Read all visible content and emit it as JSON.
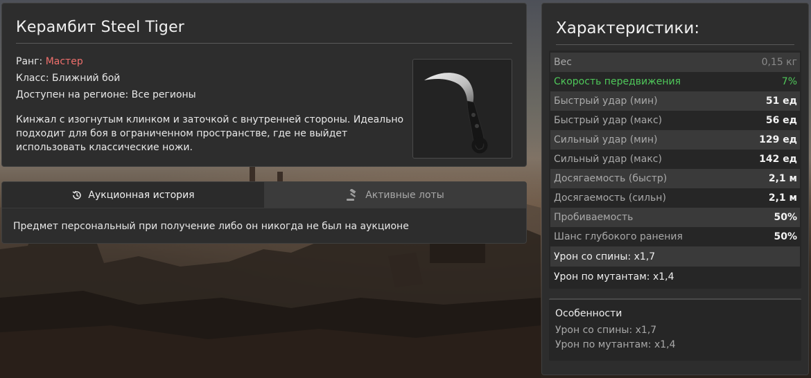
{
  "item": {
    "title": "Керамбит Steel Tiger",
    "rank_label": "Ранг:",
    "rank_value": "Мастер",
    "class_line": "Класс: Ближний бой",
    "region_line": "Доступен на регионе: Все регионы",
    "description": "Кинжал с изогнутым клинком и заточкой с внутренней стороны. Идеально подходит для боя в ограниченном пространстве, где не выйдет использовать классические ножи.",
    "image_icon": "karambit-knife-image"
  },
  "history": {
    "tabs": [
      {
        "label": "Аукционная история",
        "icon": "history-icon",
        "active": true
      },
      {
        "label": "Активные лоты",
        "icon": "gavel-icon",
        "active": false
      }
    ],
    "message": "Предмет персональный при получение либо он никогда не был на аукционе"
  },
  "stats": {
    "title": "Характеристики:",
    "rows": [
      {
        "label": "Вес",
        "value": "0,15 кг"
      },
      {
        "label": "Скорость передвижения",
        "value": "7%"
      },
      {
        "label": "Быстрый удар (мин)",
        "value": "51 ед"
      },
      {
        "label": "Быстрый удар (макс)",
        "value": "56 ед"
      },
      {
        "label": "Сильный удар (мин)",
        "value": "129 ед"
      },
      {
        "label": "Сильный удар (макс)",
        "value": "142 ед"
      },
      {
        "label": "Досягаемость (быстр)",
        "value": "2,1 м"
      },
      {
        "label": "Досягаемость (сильн)",
        "value": "2,1 м"
      },
      {
        "label": "Пробиваемость",
        "value": "50%"
      },
      {
        "label": "Шанс глубокого ранения",
        "value": "50%"
      },
      {
        "label": "Урон со спины: x1,7",
        "value": ""
      },
      {
        "label": "Урон по мутантам: x1,4",
        "value": ""
      }
    ]
  },
  "features": {
    "title": "Особенности",
    "lines": [
      "Урон со спины: x1,7",
      "Урон по мутантам: x1,4"
    ]
  },
  "colors": {
    "rank": "#ef6f6c",
    "positive": "#4fc85a",
    "panel_bg": "#2d2d2d"
  }
}
